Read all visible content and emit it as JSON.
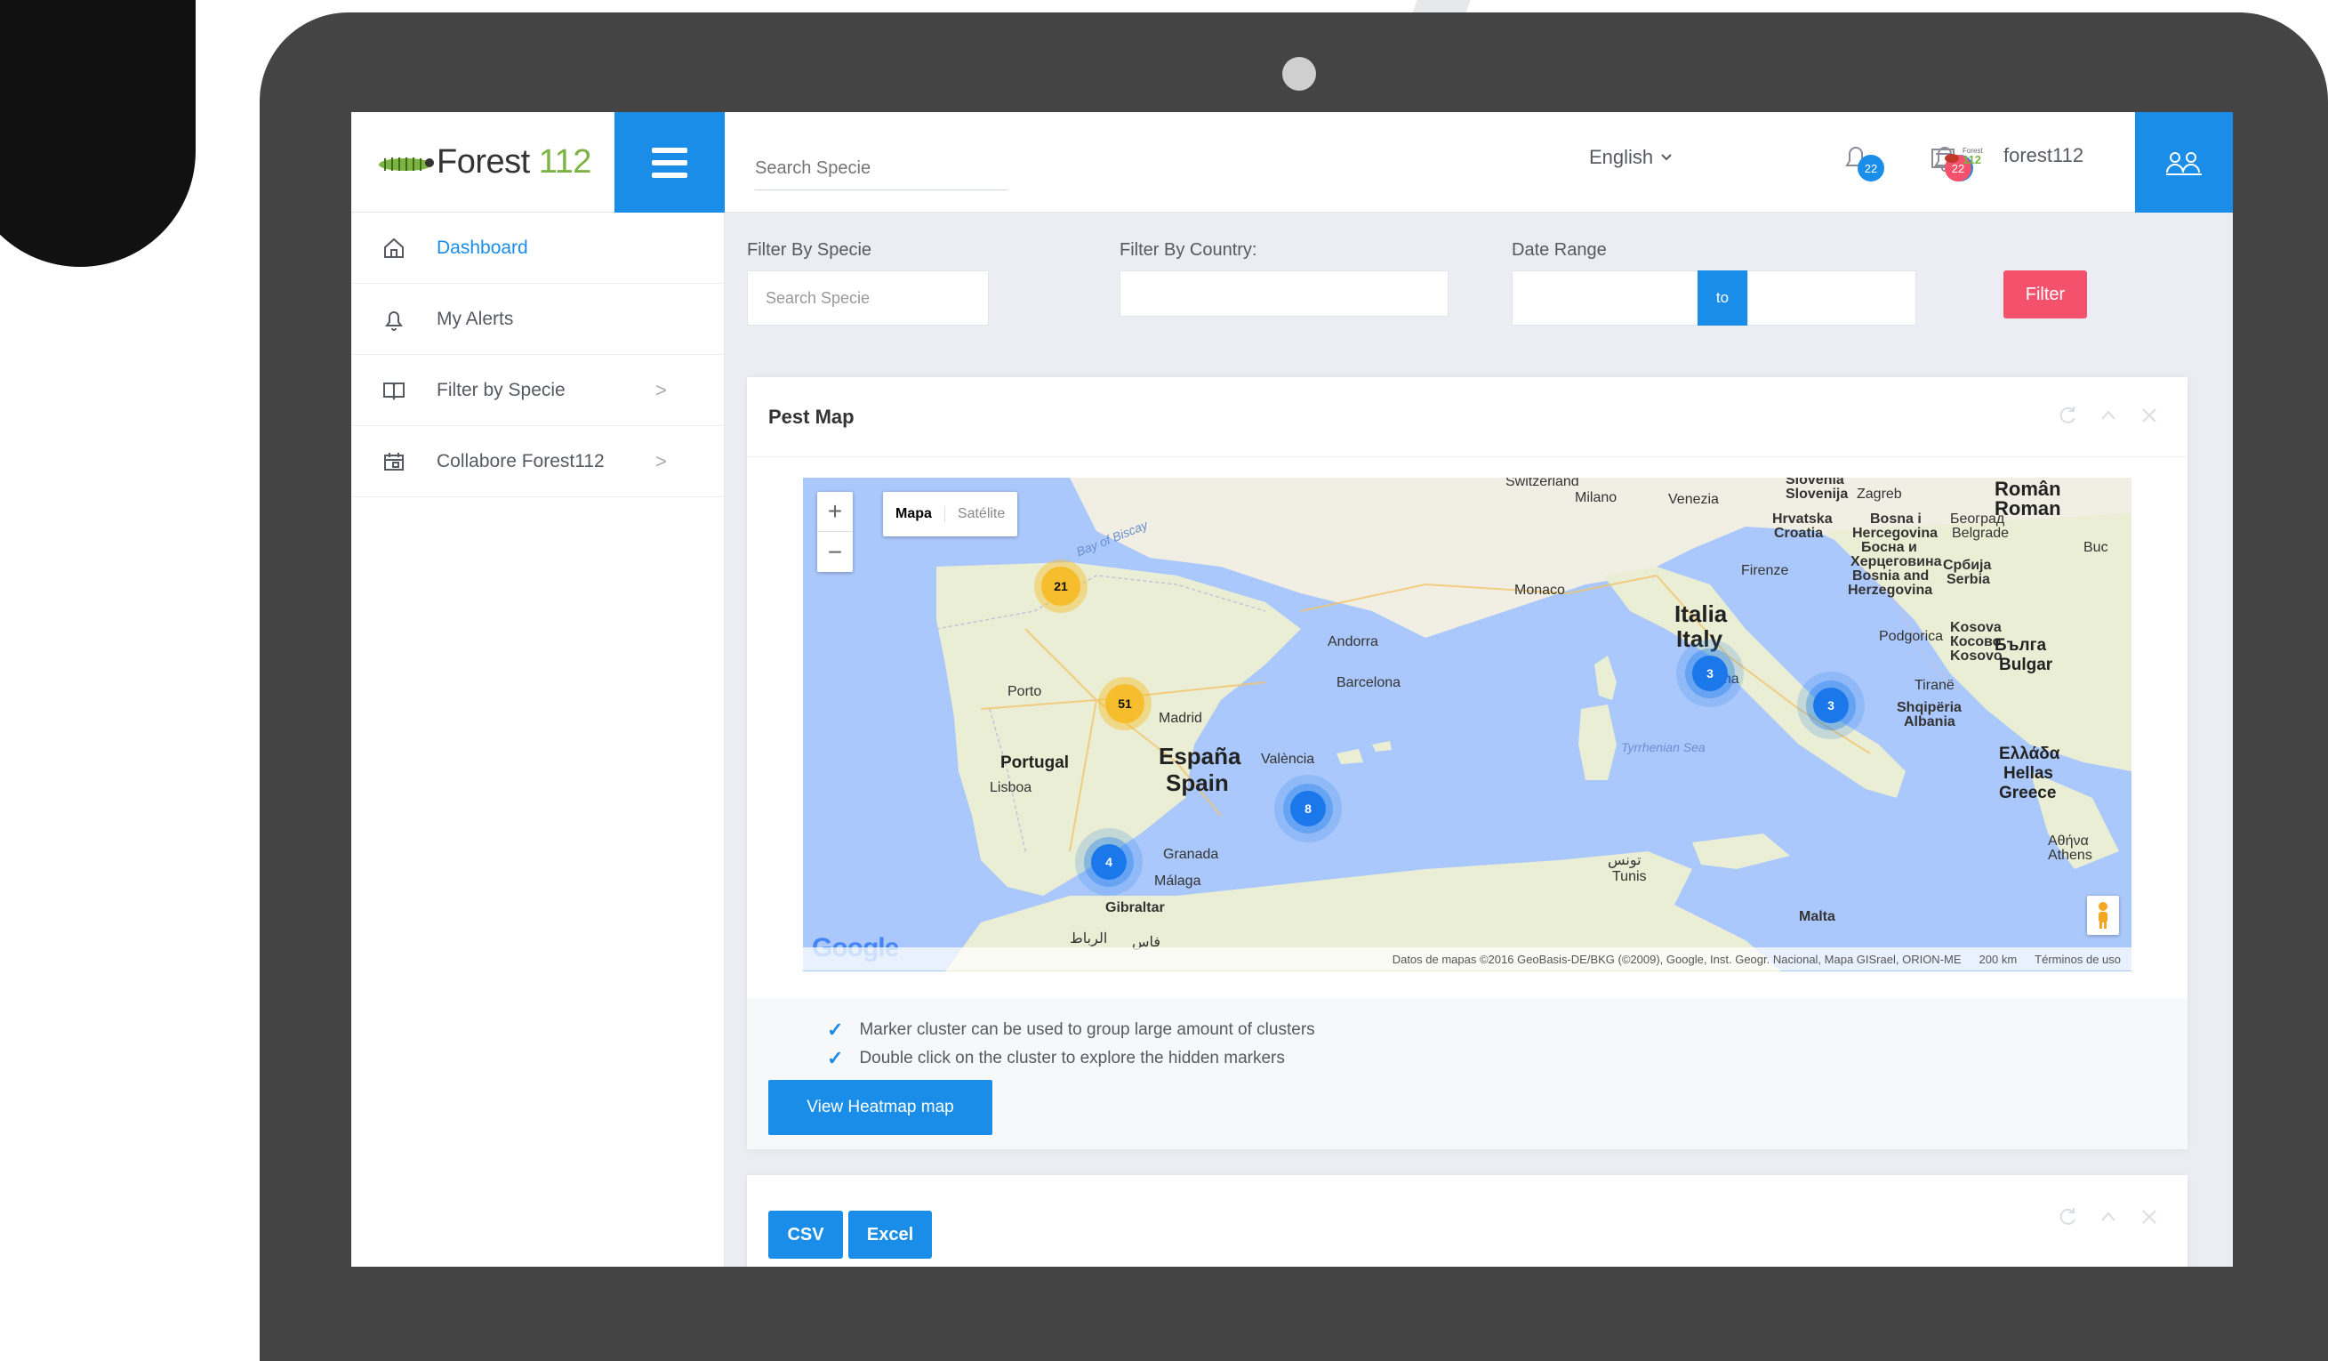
{
  "header": {
    "logo_text": "Forest",
    "logo_number": "112",
    "search_placeholder": "Search Specie",
    "language": "English",
    "notifications_count": "22",
    "messages_count": "22",
    "username": "forest112",
    "user_logo_text_top": "Forest",
    "user_logo_text_bottom": "112"
  },
  "sidebar": {
    "items": [
      {
        "label": "Dashboard",
        "icon": "home-icon",
        "active": true
      },
      {
        "label": "My Alerts",
        "icon": "bell-icon",
        "active": false
      },
      {
        "label": "Filter by Specie",
        "icon": "book-icon",
        "active": false,
        "arrow": ">"
      },
      {
        "label": "Collabore Forest112",
        "icon": "calendar-icon",
        "active": false,
        "arrow": ">"
      }
    ]
  },
  "filters": {
    "specie_label": "Filter By Specie",
    "specie_placeholder": "Search Specie",
    "country_label": "Filter By Country:",
    "date_label": "Date Range",
    "to_label": "to",
    "filter_button": "Filter"
  },
  "pest_map": {
    "title": "Pest Map",
    "map_type_map": "Mapa",
    "map_type_satellite": "Satélite",
    "zoom_in": "+",
    "zoom_out": "−",
    "google_logo": "Google",
    "attribution": "Datos de mapas ©2016 GeoBasis-DE/BKG (©2009), Google, Inst. Geogr. Nacional, Mapa GISrael, ORION-ME",
    "scale": "200 km",
    "terms": "Términos de uso",
    "clusters": [
      {
        "count": "21",
        "color": "orange"
      },
      {
        "count": "51",
        "color": "orange"
      },
      {
        "count": "4",
        "color": "blue"
      },
      {
        "count": "8",
        "color": "blue"
      },
      {
        "count": "3",
        "color": "blue"
      },
      {
        "count": "3",
        "color": "blue"
      }
    ],
    "labels": {
      "portugal": "Portugal",
      "espana": "España",
      "spain": "Spain",
      "italia": "Italia",
      "italy": "Italy",
      "madrid": "Madrid",
      "porto": "Porto",
      "lisboa": "Lisboa",
      "valencia": "València",
      "barcelona": "Barcelona",
      "andorra": "Andorra",
      "granada": "Granada",
      "malaga": "Málaga",
      "gibraltar": "Gibraltar",
      "monaco": "Monaco",
      "milano": "Milano",
      "venezia": "Venezia",
      "firenze": "Firenze",
      "roma": "Roma",
      "tyrrhenian": "Tyrrhenian Sea",
      "bay_biscay": "Bay of Biscay",
      "malta": "Malta",
      "tunis": "Tunis",
      "tunis_ar": "تونس",
      "greece": "Greece",
      "hellas": "Hellas",
      "ellada": "Ελλάδα",
      "athens": "Athens",
      "athina": "Αθήνα",
      "albania": "Albania",
      "shqiperia": "Shqipëria",
      "tirane": "Tiranë",
      "croatia": "Croatia",
      "hrvatska": "Hrvatska",
      "zagreb": "Zagreb",
      "slovenia": "Slovenia",
      "slovenija": "Slovenija",
      "serbia": "Serbia",
      "srbija": "Србија",
      "beograd": "Београд",
      "belgrade": "Belgrade",
      "bosnia_1": "Bosna i",
      "bosnia_2": "Hercegovina",
      "bosnia_3": "Босна и",
      "bosnia_4": "Херцеговина",
      "bosnia_5": "Bosnia and",
      "bosnia_6": "Herzegovina",
      "podgorica": "Podgorica",
      "kosovo_1": "Kosova",
      "kosovo_2": "Косово",
      "kosovo_3": "Kosovo",
      "bulgaria_1": "Бълга",
      "bulgaria_2": "Bulgar",
      "romania_1": "Român",
      "romania_2": "Roman",
      "switzerland": "Switzerland",
      "buc": "Buc",
      "rabat": "الرباط",
      "fes": "فاس"
    }
  },
  "notes": [
    "Marker cluster can be used to group large amount of clusters",
    "Double click on the cluster to explore the hidden markers"
  ],
  "heatmap_button": "View Heatmap map",
  "export": {
    "csv": "CSV",
    "excel": "Excel"
  },
  "colors": {
    "primary": "#1a8de9",
    "danger": "#f4516c",
    "cluster_orange": "#f6bd2c",
    "cluster_blue": "#1a78ea",
    "water": "#aac8fb",
    "land": "#f1efe3"
  }
}
